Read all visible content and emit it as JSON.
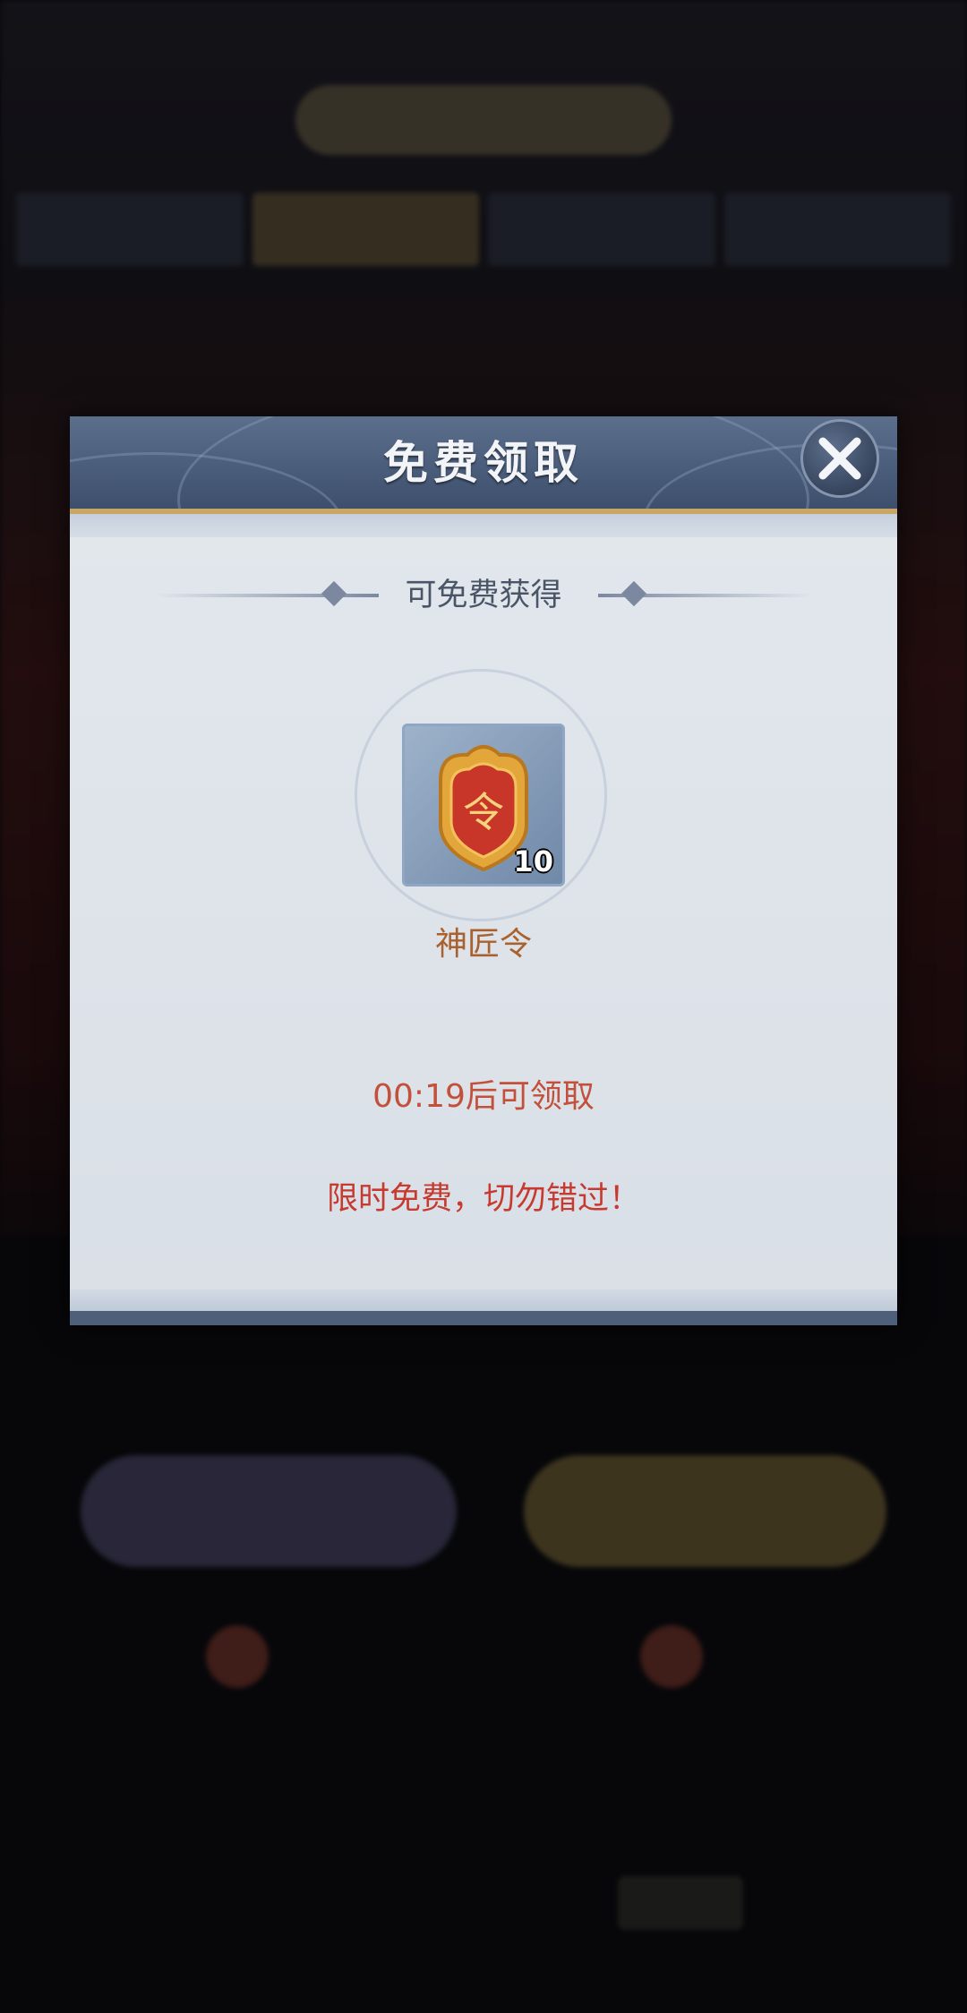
{
  "modal": {
    "title": "免费领取",
    "subtitle": "可免费获得",
    "item": {
      "name": "神匠令",
      "count": "10",
      "icon": "token-badge-icon",
      "glyph": "令"
    },
    "timer_text": "00:19后可领取",
    "promo_text": "限时免费，切勿错过！"
  },
  "colors": {
    "header": "#3d4f6c",
    "gold_trim": "#c8a766",
    "timer": "#c2503a",
    "promo": "#c73a2f",
    "item_name": "#a9622f"
  }
}
